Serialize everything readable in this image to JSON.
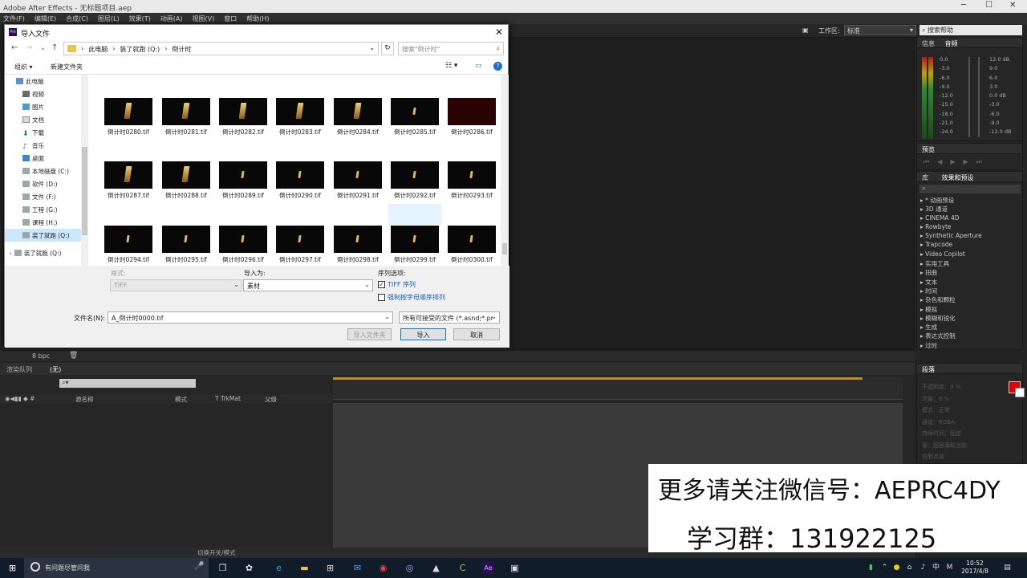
{
  "app": {
    "title": "Adobe After Effects - 无标题项目.aep",
    "menu": [
      "文件(F)",
      "编辑(E)",
      "合成(C)",
      "图层(L)",
      "效果(T)",
      "动画(A)",
      "视图(V)",
      "窗口",
      "帮助(H)"
    ],
    "workspace_label": "工作区:",
    "workspace_value": "标准",
    "help_search": "搜索帮助"
  },
  "dialog": {
    "title": "导入文件",
    "breadcrumb": [
      "此电脑",
      "装了就跑 (Q:)",
      "倒计时"
    ],
    "search_placeholder": "搜索\"倒计时\"",
    "organize": "组织 ▾",
    "new_folder": "新建文件夹",
    "tree": [
      "此电脑",
      "视频",
      "图片",
      "文档",
      "下载",
      "音乐",
      "桌面",
      "本地磁盘 (C:)",
      "软件 (D:)",
      "文件 (F:)",
      "工程 (G:)",
      "课程 (H:)",
      "装了就跑 (Q:)",
      "装了就跑 (Q:)"
    ],
    "files": [
      "倒计时0280.tif",
      "倒计时0281.tif",
      "倒计时0282.tif",
      "倒计时0283.tif",
      "倒计时0284.tif",
      "倒计时0285.tif",
      "倒计时0286.tif",
      "倒计时0287.tif",
      "倒计时0288.tif",
      "倒计时0289.tif",
      "倒计时0290.tif",
      "倒计时0291.tif",
      "倒计时0292.tif",
      "倒计时0293.tif",
      "倒计时0294.tif",
      "倒计时0295.tif",
      "倒计时0296.tif",
      "倒计时0297.tif",
      "倒计时0298.tif",
      "倒计时0299.tif",
      "倒计时0300.tif"
    ],
    "format_label": "格式:",
    "format_value": "TIFF",
    "import_as_label": "导入为:",
    "import_as_value": "素材",
    "sequence_options_label": "序列选项:",
    "tiff_sequence": "TIFF 序列",
    "tiff_sequence_checked": true,
    "force_alpha": "强制按字母顺序排列",
    "force_alpha_checked": false,
    "filename_label": "文件名(N):",
    "filename_value": "A_倒计时0000.tif",
    "filetype_value": "所有可接受的文件 (*.asnd;*.pr",
    "import_folder_btn": "导入文件夹",
    "import_btn": "导入",
    "cancel_btn": "取消"
  },
  "project_bar": {
    "bpc": "8 bpc"
  },
  "info_panel": {
    "tabs": [
      "信息",
      "音频"
    ],
    "levels_left": [
      "0.0",
      "-3.0",
      "-6.0",
      "-9.0",
      "-12.0",
      "-15.0",
      "-18.0",
      "-21.0",
      "-24.0"
    ],
    "levels_right": [
      "12.0 dB",
      "9.0",
      "6.0",
      "3.0",
      "0.0 dB",
      "-3.0",
      "-6.0",
      "-9.0",
      "-12.0 dB"
    ]
  },
  "preview_panel": {
    "tab": "预览"
  },
  "effects_panel": {
    "tabs": [
      "库",
      "效果和预设"
    ],
    "search_icon": "search-icon",
    "items": [
      "* 动画预设",
      "3D 通道",
      "CINEMA 4D",
      "Rowbyte",
      "Synthetic Aperture",
      "Trapcode",
      "Video Copilot",
      "实用工具",
      "扭曲",
      "文本",
      "时间",
      "杂色和颗粒",
      "模拟",
      "模糊和锐化",
      "生成",
      "表达式控制",
      "过时"
    ]
  },
  "paragraph_panel": {
    "tab": "段落",
    "rows": [
      "不透明度：0 %",
      "流量：0 %",
      "模式：正常",
      "通道：RGBA",
      "持续时间：固定",
      "源：图层源和当前",
      "仿制点源"
    ]
  },
  "timeline": {
    "render_queue": "渲染队列",
    "comp_tab": "(无)",
    "col_source": "源名称",
    "col_mode": "模式",
    "col_trkmat": "T  TrkMat",
    "col_parent": "父级",
    "toggle": "切换开关/模式"
  },
  "watermark": {
    "line1": "更多请关注微信号：AEPRC4DY",
    "line2": "学习群：131922125"
  },
  "taskbar": {
    "search": "有问题尽管问我",
    "time": "10:52",
    "date": "2017/4/8"
  },
  "colors": {
    "accent": "#0078d7",
    "fg_swatch": "#e00000"
  }
}
